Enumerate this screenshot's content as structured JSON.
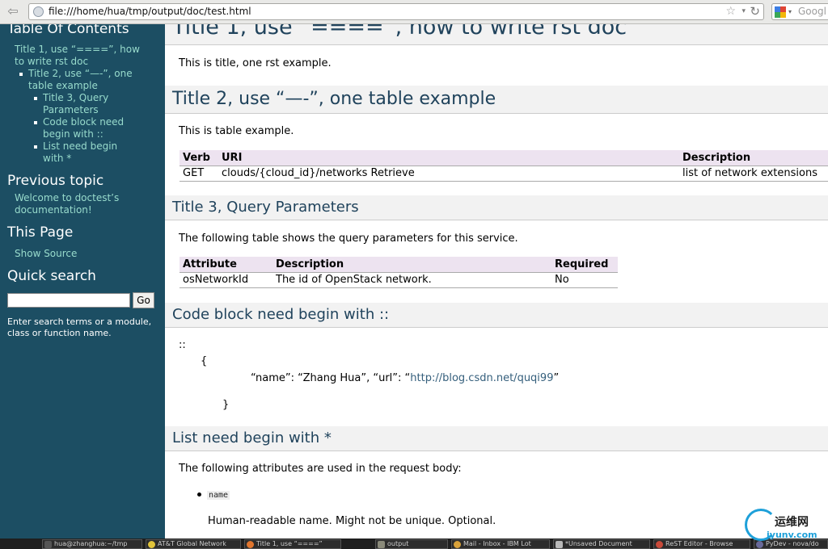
{
  "browser": {
    "back_label": "⇦",
    "url": "file:///home/hua/tmp/output/doc/test.html",
    "star": "☆",
    "dropdown": "▾",
    "reload": "↻",
    "search_placeholder": "Googl",
    "search_dropdown": "▾"
  },
  "sidebar": {
    "toc_title": "Table Of Contents",
    "toc": {
      "item1_line1": "Title 1, use “====”, how",
      "item1_line2": "to write rst doc",
      "item2_line1": "Title 2, use “—-”, one",
      "item2_line2": "table example",
      "item3_line1": "Title 3, Query",
      "item3_line2": "Parameters",
      "item4_line1": "Code block need",
      "item4_line2": "begin with ::",
      "item5_line1": "List need begin",
      "item5_line2": "with *"
    },
    "prev_title": "Previous topic",
    "prev_line1": "Welcome to doctest’s",
    "prev_line2": "documentation!",
    "this_page_title": "This Page",
    "show_source": "Show Source",
    "quick_search_title": "Quick search",
    "go_label": "Go",
    "help_line1": "Enter search terms or a module,",
    "help_line2": "class or function name."
  },
  "main": {
    "title1": "Title 1, use “====”, how to write rst doc",
    "title1_para": "This is title, one rst example.",
    "title2": "Title 2, use “—-”, one table example",
    "title2_para": "This is table example.",
    "table1": {
      "headers": [
        "Verb",
        "URI",
        "Description"
      ],
      "row": [
        "GET",
        "clouds/{cloud_id}/networks Retrieve",
        "list of network extensions"
      ]
    },
    "title3": "Title 3, Query Parameters",
    "title3_para": "The following table shows the query parameters for this service.",
    "table2": {
      "headers": [
        "Attribute",
        "Description",
        "Required"
      ],
      "row": [
        "osNetworkId",
        "The id of OpenStack network.",
        "No"
      ]
    },
    "title4": "Code block need begin with ::",
    "code": {
      "marker": "::",
      "open_brace": "{",
      "line_prefix": "“name”: “Zhang Hua”, “url”: “",
      "link": "http://blog.csdn.net/quqi99",
      "line_suffix": "”",
      "close_brace": "}"
    },
    "title5": "List need begin with *",
    "title5_para": "The following attributes are used in the request body:",
    "list_item_code": "name",
    "list_item_desc": "Human-readable name. Might not be unique. Optional."
  },
  "taskbar": {
    "tasks": [
      "hua@zhanghua:~/tmp",
      "AT&T Global Network",
      "Title 1, use “====”",
      "output",
      "Mail - Inbox - IBM Lot",
      "*Unsaved Document",
      "ReST Editor - Browse",
      "PyDev - nova/do"
    ]
  },
  "watermark": {
    "cn": "运维网",
    "url": "iyunv.com"
  },
  "colors": {
    "sidebar_bg": "#1c4e63",
    "sidebar_link": "#98dbcc",
    "heading_text": "#20435c",
    "table_header_bg": "#ede3f0"
  }
}
